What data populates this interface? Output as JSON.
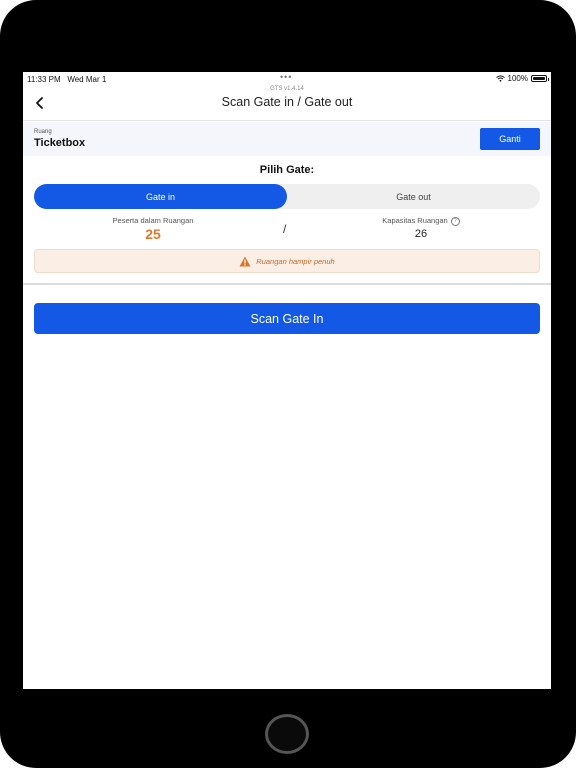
{
  "status_bar": {
    "time": "11:33 PM",
    "date": "Wed Mar 1",
    "battery": "100%"
  },
  "header": {
    "version": "GTS v1.4.14",
    "title": "Scan Gate in / Gate out",
    "back_icon": "chevron-left-icon"
  },
  "room": {
    "label": "Ruang",
    "name": "Ticketbox",
    "change_button": "Ganti"
  },
  "gate": {
    "heading": "Pilih Gate:",
    "options": [
      "Gate in",
      "Gate out"
    ],
    "selected": "Gate in"
  },
  "stats": {
    "participants_label": "Peserta dalam Ruangan",
    "participants_value": "25",
    "separator": "/",
    "capacity_label": "Kapasitas Ruangan",
    "capacity_value": "26"
  },
  "warning": {
    "text": "Ruangan hampir penuh",
    "icon": "warning-triangle-icon"
  },
  "scan_button": "Scan Gate In",
  "colors": {
    "primary": "#1459e5",
    "participants": "#d97a2e",
    "warning_bg": "#fbeee4",
    "warning_text": "#c46a2c"
  }
}
